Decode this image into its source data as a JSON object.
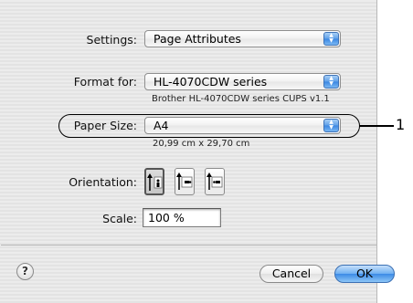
{
  "settings": {
    "label": "Settings:",
    "value": "Page Attributes"
  },
  "format_for": {
    "label": "Format for:",
    "value": "HL-4070CDW series",
    "description": "Brother HL-4070CDW series CUPS v1.1"
  },
  "paper_size": {
    "label": "Paper Size:",
    "value": "A4",
    "dimensions": "20,99 cm x 29,70 cm"
  },
  "orientation": {
    "label": "Orientation:",
    "options": [
      "portrait-icon",
      "landscape-icon",
      "reverse-landscape-icon"
    ],
    "selected": 0
  },
  "scale": {
    "label": "Scale:",
    "value": "100 %"
  },
  "footer": {
    "help": "?",
    "cancel_label": "Cancel",
    "ok_label": "OK"
  },
  "callout": {
    "number": "1"
  },
  "colors": {
    "accent": "#3c8ae6",
    "popup_arrow": "#5d9ee8"
  }
}
